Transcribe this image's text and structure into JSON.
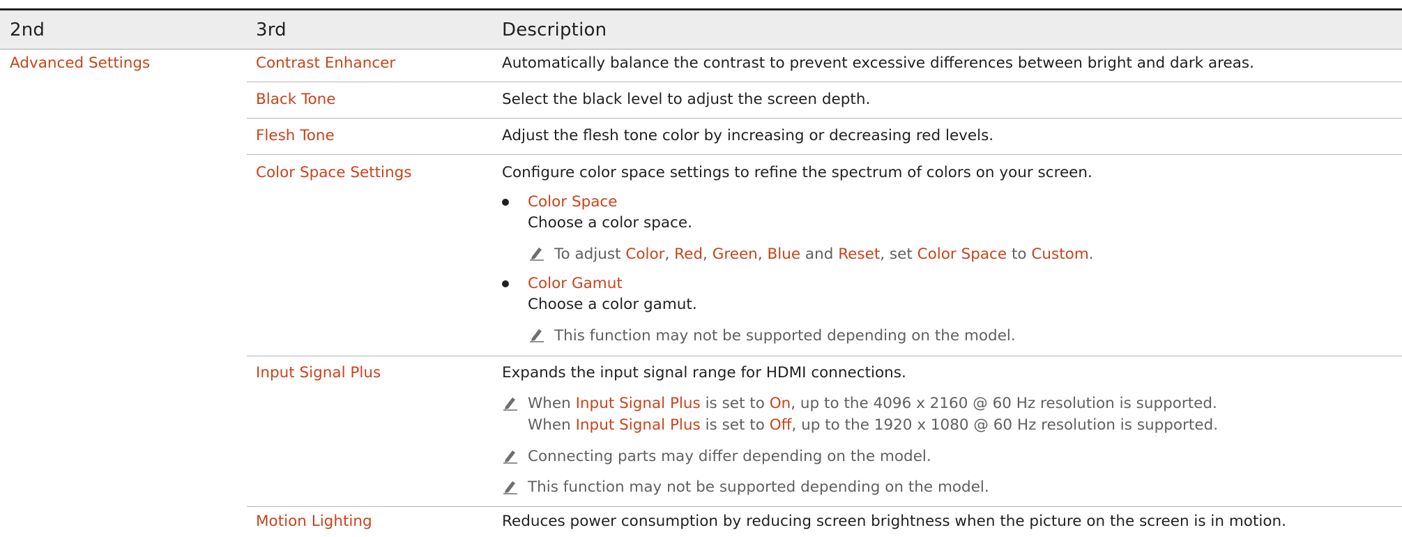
{
  "header": {
    "col_2nd": "2nd",
    "col_3rd": "3rd",
    "col_desc": "Description"
  },
  "rows": {
    "parent": "Advanced Settings",
    "contrast": {
      "label": "Contrast Enhancer",
      "desc": "Automatically balance the contrast to prevent excessive differences between bright and dark areas."
    },
    "black": {
      "label": "Black Tone",
      "desc": "Select the black level to adjust the screen depth."
    },
    "flesh": {
      "label": "Flesh Tone",
      "desc": "Adjust the flesh tone color by increasing or decreasing red levels."
    },
    "colorspace": {
      "label": "Color Space Settings",
      "desc": "Configure color space settings to refine the spectrum of colors on your screen.",
      "b1_title": "Color Space",
      "b1_desc": "Choose a color space.",
      "b1_note": {
        "t1": "To adjust ",
        "k1": "Color",
        "s1": ", ",
        "k2": "Red",
        "s2": ", ",
        "k3": "Green",
        "s3": ", ",
        "k4": "Blue",
        "s4": " and ",
        "k5": "Reset",
        "s5": ", set ",
        "k6": "Color Space",
        "s6": " to ",
        "k7": "Custom",
        "s7": "."
      },
      "b2_title": "Color Gamut",
      "b2_desc": "Choose a color gamut.",
      "b2_note": "This function may not be supported depending on the model."
    },
    "input": {
      "label": "Input Signal Plus",
      "desc": "Expands the input signal range for HDMI connections.",
      "n1a": {
        "t1": "When ",
        "k1": "Input Signal Plus",
        "t2": " is set to ",
        "k2": "On",
        "t3": ", up to the 4096 x 2160 @ 60 Hz resolution is supported."
      },
      "n1b": {
        "t1": "When ",
        "k1": "Input Signal Plus",
        "t2": " is set to ",
        "k2": "Off",
        "t3": ", up to the 1920 x 1080 @ 60 Hz resolution is supported."
      },
      "n2": "Connecting parts may differ depending on the model.",
      "n3": "This function may not be supported depending on the model."
    },
    "motion": {
      "label": "Motion Lighting",
      "desc": "Reduces power consumption by reducing screen brightness when the picture on the screen is in motion."
    }
  },
  "colors": {
    "accent": "#c8441b",
    "text": "#231f20",
    "note": "#606060",
    "header_bg": "#ededed"
  },
  "icons": {
    "note": "pencil-note-icon",
    "bullet": "bullet-dot"
  }
}
